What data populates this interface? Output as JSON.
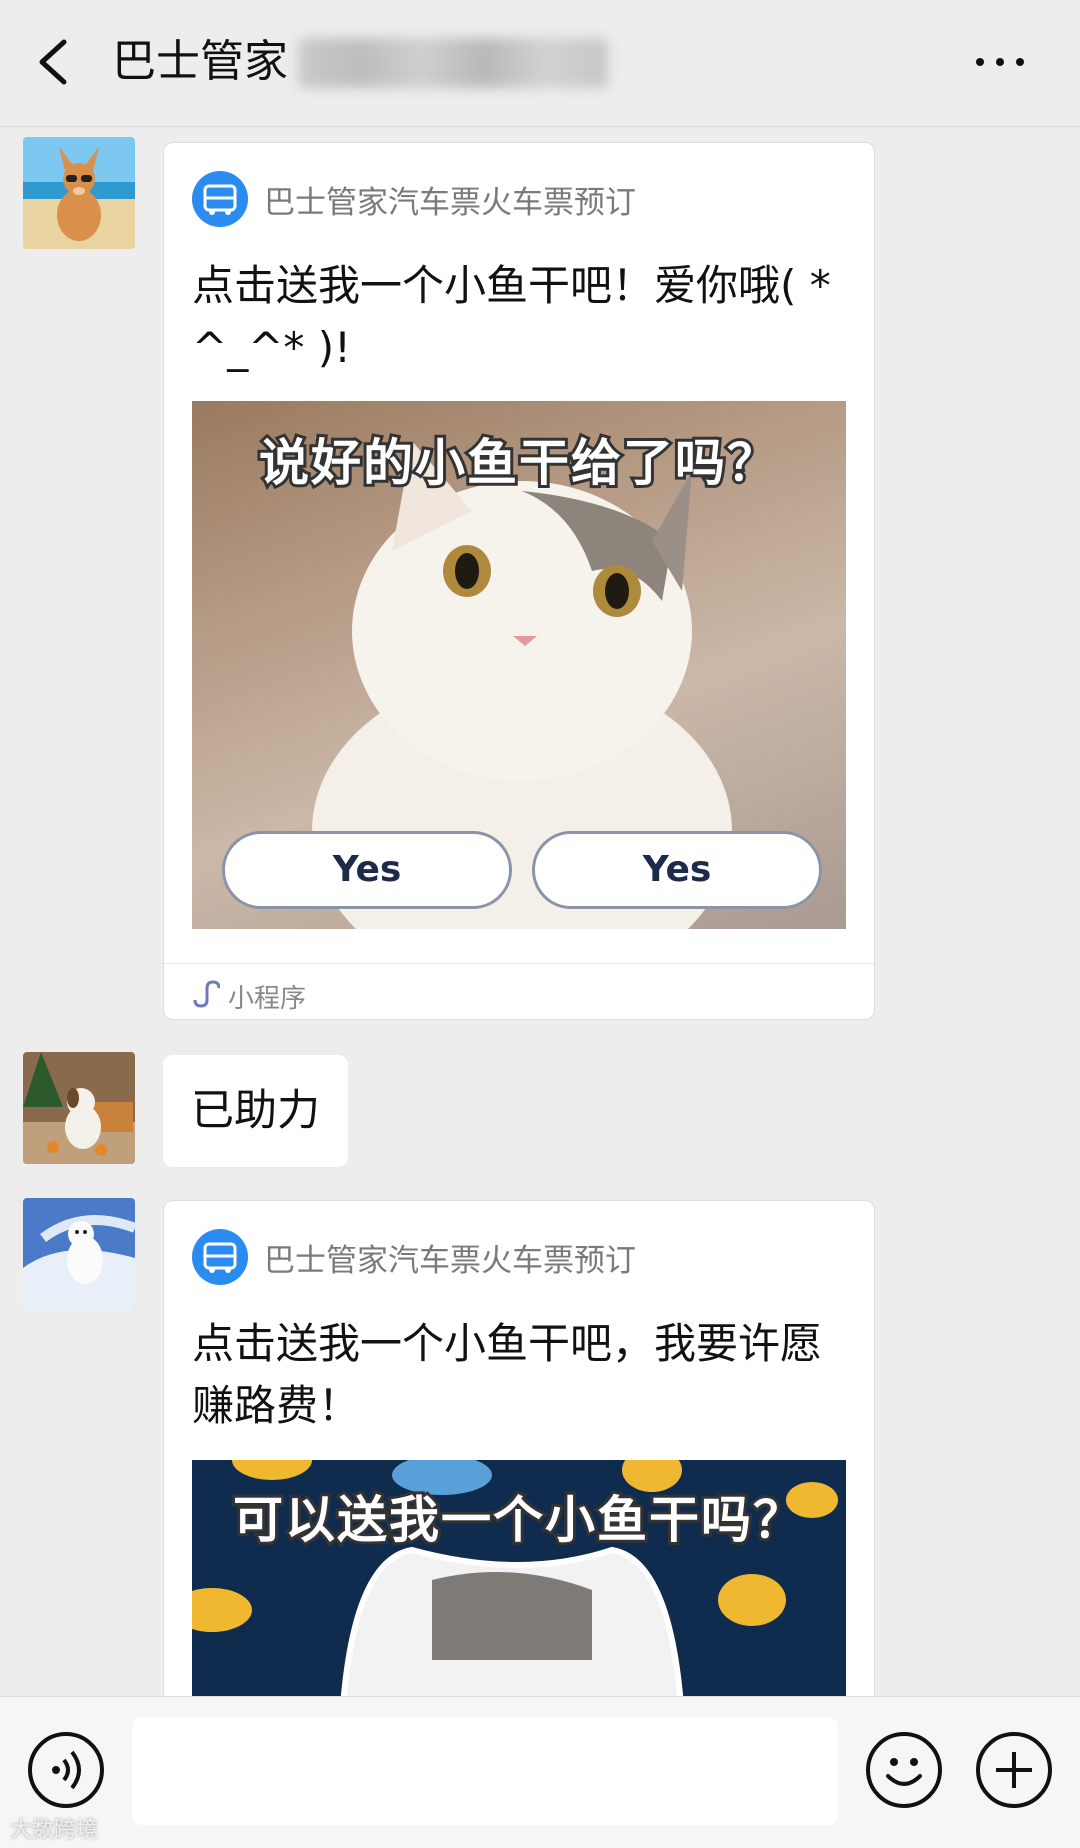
{
  "header": {
    "title": "巴士管家",
    "back_icon": "chevron-left-icon",
    "more_icon": "more-dots-icon"
  },
  "messages": [
    {
      "type": "mini-program-card",
      "app_name": "巴士管家汽车票火车票预订",
      "text": "点击送我一个小鱼干吧！爱你哦( *^_^* )!",
      "image_caption": "说好的小鱼干给了吗？",
      "buttons": [
        "Yes",
        "Yes"
      ],
      "footer_label": "小程序"
    },
    {
      "type": "text",
      "text": "已助力"
    },
    {
      "type": "mini-program-card",
      "app_name": "巴士管家汽车票火车票预订",
      "text": "点击送我一个小鱼干吧，我要许愿赚路费！",
      "image_caption": "可以送我一个小鱼干吗？"
    }
  ],
  "input_bar": {
    "voice_icon": "voice-icon",
    "emoji_icon": "emoji-icon",
    "plus_icon": "plus-icon"
  },
  "watermark": "大数跨境",
  "colors": {
    "background": "#ededed",
    "app_logo": "#2a8cf0"
  }
}
